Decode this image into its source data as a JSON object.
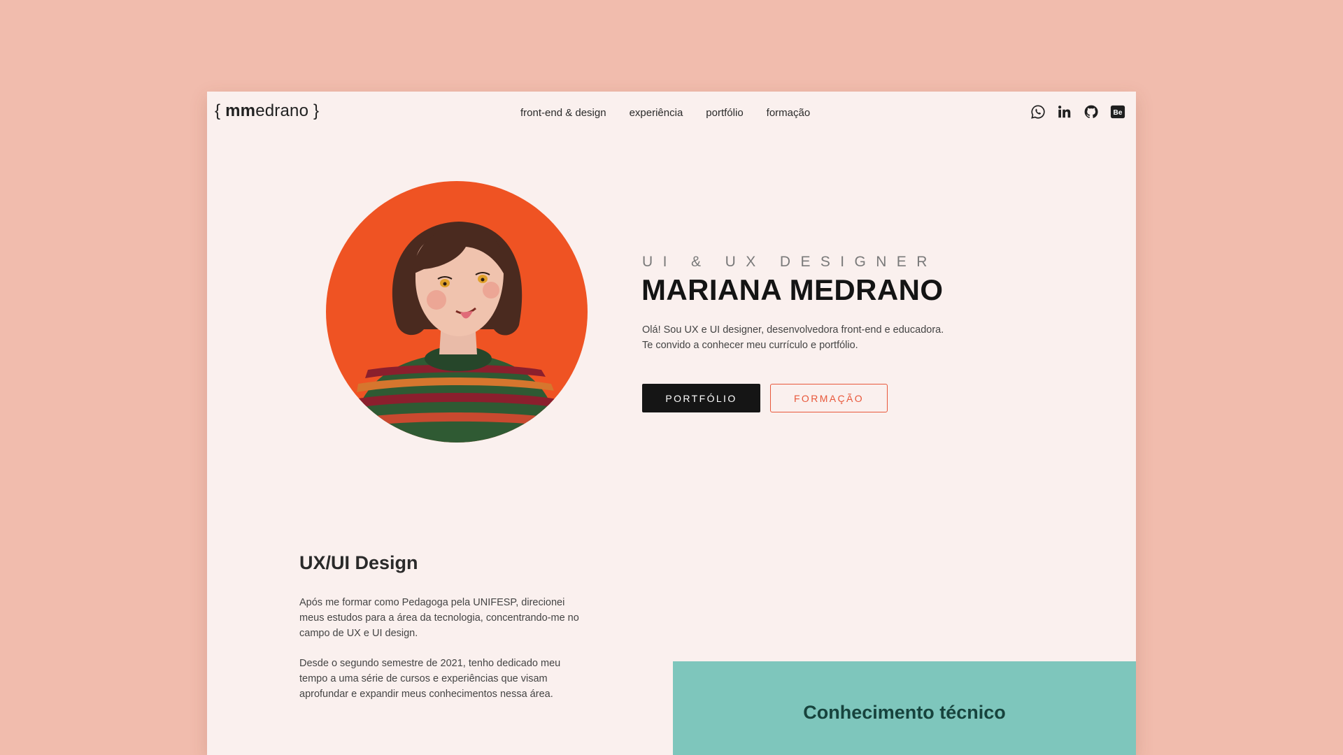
{
  "header": {
    "logo": {
      "open": "{",
      "bold": "mm",
      "rest": "edrano",
      "close": "}"
    },
    "nav": [
      "front-end & design",
      "experiência",
      "portfólio",
      "formação"
    ],
    "socials": [
      "whatsapp-icon",
      "linkedin-icon",
      "github-icon",
      "behance-icon"
    ]
  },
  "hero": {
    "subtitle": "UI & UX DESIGNER",
    "name": "MARIANA MEDRANO",
    "intro_line1": "Olá! Sou UX e UI designer, desenvolvedora front-end e educadora.",
    "intro_line2": "Te convido a conhecer meu currículo e portfólio.",
    "btn_primary": "PORTFÓLIO",
    "btn_secondary": "FORMAÇÃO"
  },
  "about": {
    "title": "UX/UI Design",
    "p1": "Após me formar como Pedagoga pela UNIFESP, direcionei meus estudos para a área da tecnologia, concentrando-me no campo de UX e UI design.",
    "p2": "Desde o segundo semestre de 2021, tenho dedicado meu tempo a uma série de cursos e experiências que visam aprofundar e expandir meus conhecimentos nessa área."
  },
  "skills": {
    "title": "Conhecimento técnico"
  },
  "colors": {
    "background": "#f1bcad",
    "page": "#faf0ee",
    "accent": "#ef5323",
    "teal": "#7ec6bc",
    "dark": "#151515"
  }
}
